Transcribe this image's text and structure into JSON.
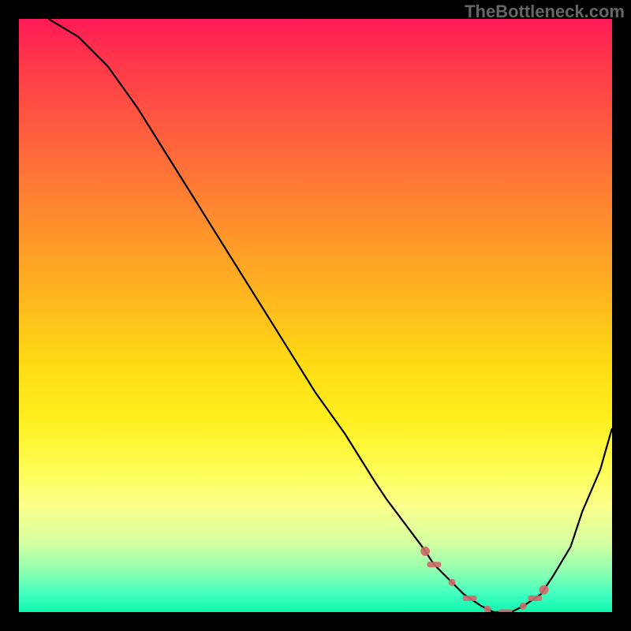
{
  "watermark": "TheBottleneck.com",
  "chart_data": {
    "type": "line",
    "title": "",
    "xlabel": "",
    "ylabel": "",
    "xlim": [
      0,
      100
    ],
    "ylim": [
      0,
      100
    ],
    "background_gradient": {
      "from_color": "#ff1a55",
      "to_color": "#10f5b0",
      "direction": "vertical"
    },
    "series": [
      {
        "name": "bottleneck-curve",
        "x": [
          5,
          10,
          15,
          20,
          25,
          30,
          35,
          40,
          45,
          50,
          55,
          60,
          62,
          65,
          68,
          70,
          73,
          75,
          78,
          80,
          83,
          85,
          88,
          90,
          93,
          95,
          98,
          100
        ],
        "values": [
          100,
          97,
          92,
          85,
          77,
          69,
          61,
          53,
          45,
          37,
          30,
          22,
          19,
          15,
          11,
          8,
          5,
          3,
          1,
          0,
          0,
          1,
          3,
          6,
          11,
          17,
          24,
          31
        ]
      }
    ],
    "optimal_region": {
      "x_start": 72,
      "x_end": 90
    },
    "markers": {
      "kind": "dashed-dots",
      "color": "#cf6a6a",
      "x_positions": [
        68.5,
        70.0,
        73.0,
        76.0,
        79.0,
        82.0,
        85.0,
        87.0,
        88.5
      ]
    }
  }
}
